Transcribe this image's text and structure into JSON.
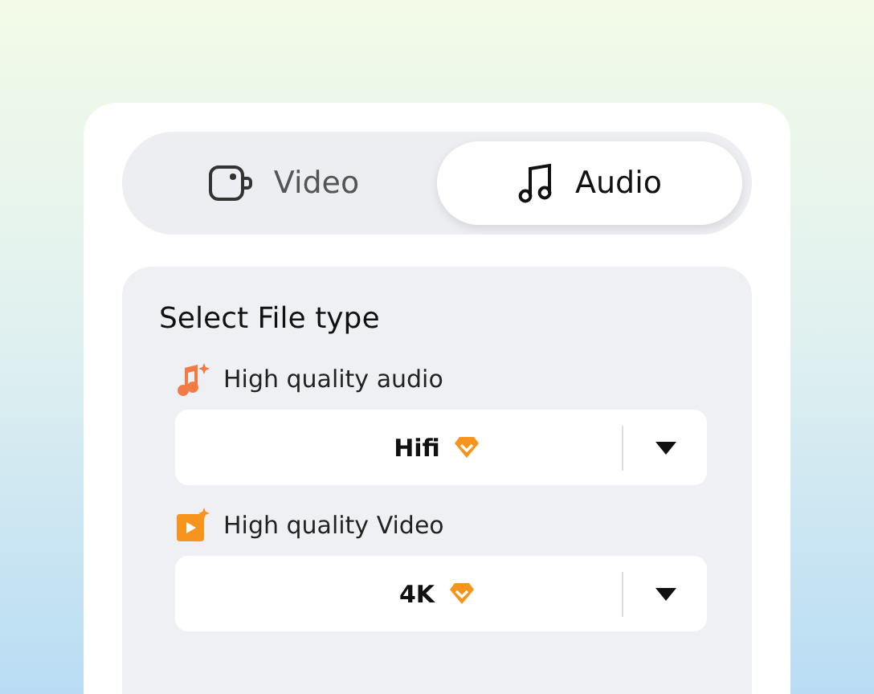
{
  "tabs": [
    {
      "label": "Video",
      "kind": "video",
      "selected": false
    },
    {
      "label": "Audio",
      "kind": "audio",
      "selected": true
    }
  ],
  "panel": {
    "title": "Select File type",
    "options": [
      {
        "kind": "audio",
        "label": "High quality audio",
        "value": "Hifi",
        "premium": true
      },
      {
        "kind": "video",
        "label": "High quality Video",
        "value": "4K",
        "premium": true
      }
    ]
  }
}
